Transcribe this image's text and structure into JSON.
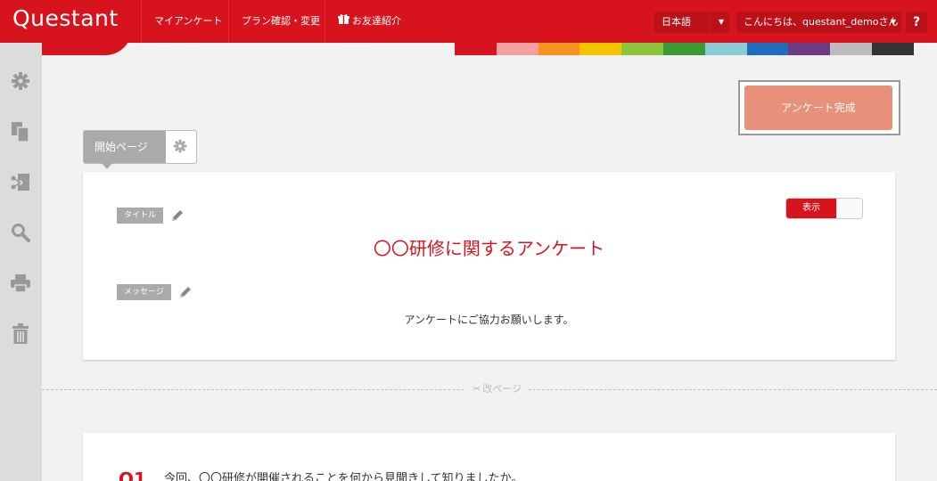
{
  "header": {
    "logo": "Questant",
    "nav": [
      {
        "label": "マイアンケート"
      },
      {
        "label": "プラン確認・変更"
      },
      {
        "label": "お友達紹介"
      }
    ],
    "language": "日本語",
    "greeting": "こんにちは、questant_demoさん",
    "help": "?"
  },
  "color_strip": [
    "#d7141d",
    "#f4a0a0",
    "#f7931e",
    "#f5c400",
    "#8cc43a",
    "#3a9a35",
    "#8ccbd4",
    "#1f6ebd",
    "#6d3a84",
    "#bcbcbc",
    "#333333"
  ],
  "sidebar": {
    "icons": [
      "gear-icon",
      "copy-icon",
      "share-icon",
      "search-icon",
      "print-icon",
      "trash-icon"
    ]
  },
  "actions": {
    "complete": "アンケート完成"
  },
  "start_page": {
    "label": "開始ページ"
  },
  "intro_card": {
    "title_chip": "タイトル",
    "message_chip": "メッセージ",
    "toggle_label": "表示",
    "title": "〇〇研修に関するアンケート",
    "message": "アンケートにご協力お願いします。"
  },
  "page_break": {
    "label": "改ページ"
  },
  "question": {
    "number": "Q1",
    "text": "今回、〇〇研修が開催されることを何から見聞きして知りましたか。"
  }
}
